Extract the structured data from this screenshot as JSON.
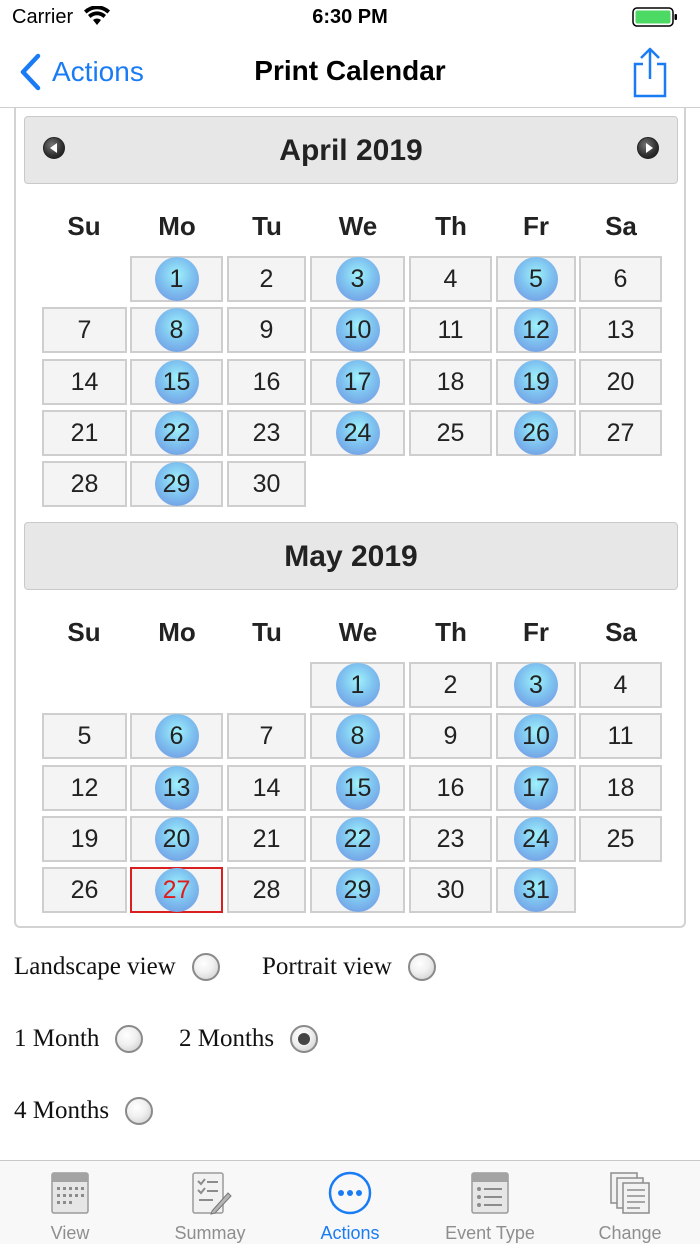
{
  "status_bar": {
    "carrier": "Carrier",
    "time": "6:30 PM"
  },
  "nav": {
    "back_label": "Actions",
    "title": "Print Calendar"
  },
  "icons": {
    "back": "chevron-left-icon",
    "share": "share-icon",
    "prev": "prev-month-icon",
    "next": "next-month-icon"
  },
  "accent_color": "#1a7cf5",
  "months": [
    {
      "title": "April 2019",
      "weekdays": [
        "Su",
        "Mo",
        "Tu",
        "We",
        "Th",
        "Fr",
        "Sa"
      ],
      "weeks": [
        [
          null,
          {
            "d": "1",
            "m": true
          },
          {
            "d": "2"
          },
          {
            "d": "3",
            "m": true
          },
          {
            "d": "4"
          },
          {
            "d": "5",
            "m": true
          },
          {
            "d": "6"
          }
        ],
        [
          {
            "d": "7"
          },
          {
            "d": "8",
            "m": true
          },
          {
            "d": "9"
          },
          {
            "d": "10",
            "m": true
          },
          {
            "d": "11"
          },
          {
            "d": "12",
            "m": true
          },
          {
            "d": "13"
          }
        ],
        [
          {
            "d": "14"
          },
          {
            "d": "15",
            "m": true
          },
          {
            "d": "16"
          },
          {
            "d": "17",
            "m": true
          },
          {
            "d": "18"
          },
          {
            "d": "19",
            "m": true
          },
          {
            "d": "20"
          }
        ],
        [
          {
            "d": "21"
          },
          {
            "d": "22",
            "m": true
          },
          {
            "d": "23"
          },
          {
            "d": "24",
            "m": true
          },
          {
            "d": "25"
          },
          {
            "d": "26",
            "m": true
          },
          {
            "d": "27"
          }
        ],
        [
          {
            "d": "28"
          },
          {
            "d": "29",
            "m": true
          },
          {
            "d": "30"
          },
          null,
          null,
          null,
          null
        ]
      ]
    },
    {
      "title": "May 2019",
      "weekdays": [
        "Su",
        "Mo",
        "Tu",
        "We",
        "Th",
        "Fr",
        "Sa"
      ],
      "weeks": [
        [
          null,
          null,
          null,
          {
            "d": "1",
            "m": true
          },
          {
            "d": "2"
          },
          {
            "d": "3",
            "m": true
          },
          {
            "d": "4"
          }
        ],
        [
          {
            "d": "5"
          },
          {
            "d": "6",
            "m": true
          },
          {
            "d": "7"
          },
          {
            "d": "8",
            "m": true
          },
          {
            "d": "9"
          },
          {
            "d": "10",
            "m": true
          },
          {
            "d": "11"
          }
        ],
        [
          {
            "d": "12"
          },
          {
            "d": "13",
            "m": true
          },
          {
            "d": "14"
          },
          {
            "d": "15",
            "m": true
          },
          {
            "d": "16"
          },
          {
            "d": "17",
            "m": true
          },
          {
            "d": "18"
          }
        ],
        [
          {
            "d": "19"
          },
          {
            "d": "20",
            "m": true
          },
          {
            "d": "21"
          },
          {
            "d": "22",
            "m": true
          },
          {
            "d": "23"
          },
          {
            "d": "24",
            "m": true
          },
          {
            "d": "25"
          }
        ],
        [
          {
            "d": "26"
          },
          {
            "d": "27",
            "m": true,
            "today": true
          },
          {
            "d": "28"
          },
          {
            "d": "29",
            "m": true
          },
          {
            "d": "30"
          },
          {
            "d": "31",
            "m": true
          },
          null
        ]
      ]
    }
  ],
  "options": {
    "landscape": {
      "label": "Landscape view",
      "selected": false
    },
    "portrait": {
      "label": "Portrait view",
      "selected": false
    },
    "one_month": {
      "label": "1 Month",
      "selected": false
    },
    "two_months": {
      "label": "2 Months",
      "selected": true
    },
    "four_months": {
      "label": "4 Months",
      "selected": false
    }
  },
  "tabs": [
    {
      "label": "View",
      "icon": "calendar-icon",
      "active": false
    },
    {
      "label": "Summay",
      "icon": "checklist-icon",
      "active": false
    },
    {
      "label": "Actions",
      "icon": "more-icon",
      "active": true
    },
    {
      "label": "Event Type",
      "icon": "event-type-icon",
      "active": false
    },
    {
      "label": "Change",
      "icon": "documents-icon",
      "active": false
    }
  ]
}
